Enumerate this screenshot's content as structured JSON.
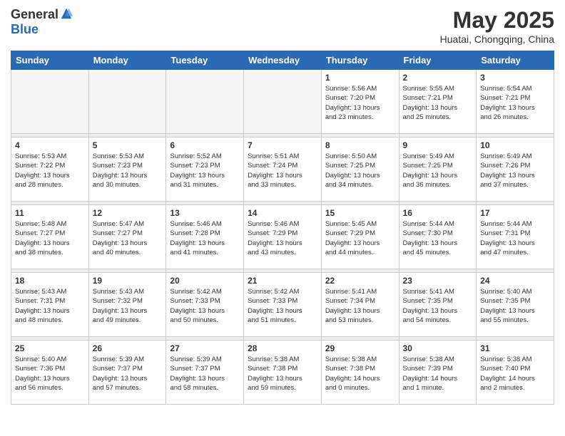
{
  "header": {
    "logo_general": "General",
    "logo_blue": "Blue",
    "month_title": "May 2025",
    "location": "Huatai, Chongqing, China"
  },
  "days_of_week": [
    "Sunday",
    "Monday",
    "Tuesday",
    "Wednesday",
    "Thursday",
    "Friday",
    "Saturday"
  ],
  "weeks": [
    [
      {
        "day": "",
        "info": ""
      },
      {
        "day": "",
        "info": ""
      },
      {
        "day": "",
        "info": ""
      },
      {
        "day": "",
        "info": ""
      },
      {
        "day": "1",
        "info": "Sunrise: 5:56 AM\nSunset: 7:20 PM\nDaylight: 13 hours\nand 23 minutes."
      },
      {
        "day": "2",
        "info": "Sunrise: 5:55 AM\nSunset: 7:21 PM\nDaylight: 13 hours\nand 25 minutes."
      },
      {
        "day": "3",
        "info": "Sunrise: 5:54 AM\nSunset: 7:21 PM\nDaylight: 13 hours\nand 26 minutes."
      }
    ],
    [
      {
        "day": "4",
        "info": "Sunrise: 5:53 AM\nSunset: 7:22 PM\nDaylight: 13 hours\nand 28 minutes."
      },
      {
        "day": "5",
        "info": "Sunrise: 5:53 AM\nSunset: 7:23 PM\nDaylight: 13 hours\nand 30 minutes."
      },
      {
        "day": "6",
        "info": "Sunrise: 5:52 AM\nSunset: 7:23 PM\nDaylight: 13 hours\nand 31 minutes."
      },
      {
        "day": "7",
        "info": "Sunrise: 5:51 AM\nSunset: 7:24 PM\nDaylight: 13 hours\nand 33 minutes."
      },
      {
        "day": "8",
        "info": "Sunrise: 5:50 AM\nSunset: 7:25 PM\nDaylight: 13 hours\nand 34 minutes."
      },
      {
        "day": "9",
        "info": "Sunrise: 5:49 AM\nSunset: 7:25 PM\nDaylight: 13 hours\nand 36 minutes."
      },
      {
        "day": "10",
        "info": "Sunrise: 5:49 AM\nSunset: 7:26 PM\nDaylight: 13 hours\nand 37 minutes."
      }
    ],
    [
      {
        "day": "11",
        "info": "Sunrise: 5:48 AM\nSunset: 7:27 PM\nDaylight: 13 hours\nand 38 minutes."
      },
      {
        "day": "12",
        "info": "Sunrise: 5:47 AM\nSunset: 7:27 PM\nDaylight: 13 hours\nand 40 minutes."
      },
      {
        "day": "13",
        "info": "Sunrise: 5:46 AM\nSunset: 7:28 PM\nDaylight: 13 hours\nand 41 minutes."
      },
      {
        "day": "14",
        "info": "Sunrise: 5:46 AM\nSunset: 7:29 PM\nDaylight: 13 hours\nand 43 minutes."
      },
      {
        "day": "15",
        "info": "Sunrise: 5:45 AM\nSunset: 7:29 PM\nDaylight: 13 hours\nand 44 minutes."
      },
      {
        "day": "16",
        "info": "Sunrise: 5:44 AM\nSunset: 7:30 PM\nDaylight: 13 hours\nand 45 minutes."
      },
      {
        "day": "17",
        "info": "Sunrise: 5:44 AM\nSunset: 7:31 PM\nDaylight: 13 hours\nand 47 minutes."
      }
    ],
    [
      {
        "day": "18",
        "info": "Sunrise: 5:43 AM\nSunset: 7:31 PM\nDaylight: 13 hours\nand 48 minutes."
      },
      {
        "day": "19",
        "info": "Sunrise: 5:43 AM\nSunset: 7:32 PM\nDaylight: 13 hours\nand 49 minutes."
      },
      {
        "day": "20",
        "info": "Sunrise: 5:42 AM\nSunset: 7:33 PM\nDaylight: 13 hours\nand 50 minutes."
      },
      {
        "day": "21",
        "info": "Sunrise: 5:42 AM\nSunset: 7:33 PM\nDaylight: 13 hours\nand 51 minutes."
      },
      {
        "day": "22",
        "info": "Sunrise: 5:41 AM\nSunset: 7:34 PM\nDaylight: 13 hours\nand 53 minutes."
      },
      {
        "day": "23",
        "info": "Sunrise: 5:41 AM\nSunset: 7:35 PM\nDaylight: 13 hours\nand 54 minutes."
      },
      {
        "day": "24",
        "info": "Sunrise: 5:40 AM\nSunset: 7:35 PM\nDaylight: 13 hours\nand 55 minutes."
      }
    ],
    [
      {
        "day": "25",
        "info": "Sunrise: 5:40 AM\nSunset: 7:36 PM\nDaylight: 13 hours\nand 56 minutes."
      },
      {
        "day": "26",
        "info": "Sunrise: 5:39 AM\nSunset: 7:37 PM\nDaylight: 13 hours\nand 57 minutes."
      },
      {
        "day": "27",
        "info": "Sunrise: 5:39 AM\nSunset: 7:37 PM\nDaylight: 13 hours\nand 58 minutes."
      },
      {
        "day": "28",
        "info": "Sunrise: 5:38 AM\nSunset: 7:38 PM\nDaylight: 13 hours\nand 59 minutes."
      },
      {
        "day": "29",
        "info": "Sunrise: 5:38 AM\nSunset: 7:38 PM\nDaylight: 14 hours\nand 0 minutes."
      },
      {
        "day": "30",
        "info": "Sunrise: 5:38 AM\nSunset: 7:39 PM\nDaylight: 14 hours\nand 1 minute."
      },
      {
        "day": "31",
        "info": "Sunrise: 5:38 AM\nSunset: 7:40 PM\nDaylight: 14 hours\nand 2 minutes."
      }
    ]
  ]
}
